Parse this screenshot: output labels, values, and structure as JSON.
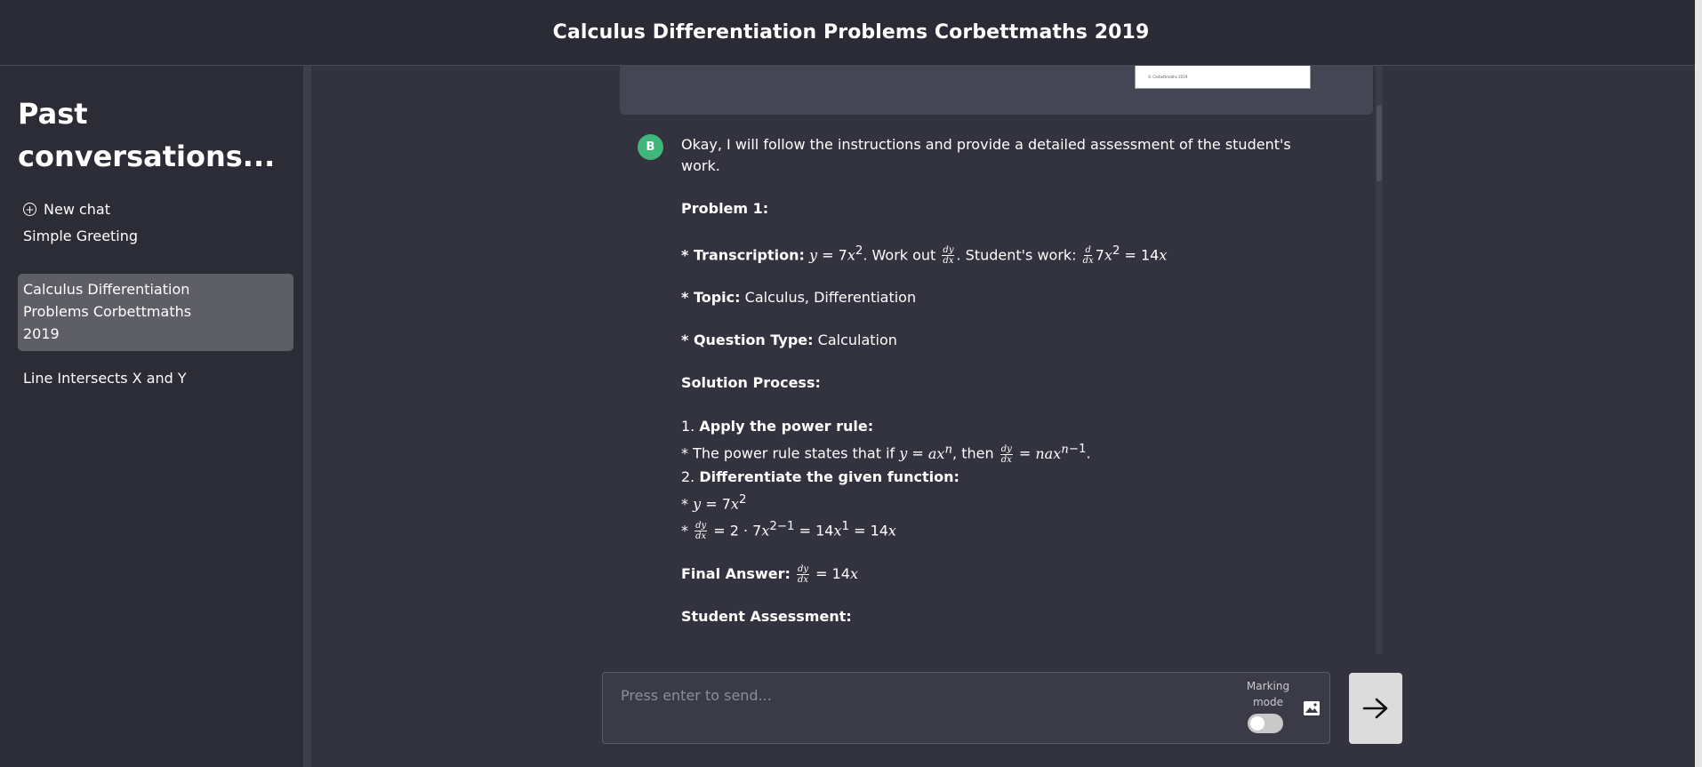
{
  "header": {
    "title": "Calculus Differentiation Problems Corbettmaths 2019"
  },
  "sidebar": {
    "heading": "Past conversations...",
    "new_chat_label": "New chat",
    "conversations": [
      {
        "label": "Simple Greeting"
      },
      {
        "label": "Calculus Differentiation Problems Corbettmaths 2019"
      },
      {
        "label": "Line Intersects X and Y"
      }
    ]
  },
  "chat": {
    "image_caption": "© Corbettmaths 2019",
    "assistant_avatar": "B",
    "message": {
      "intro": "Okay, I will follow the instructions and provide a detailed assessment of the student's work.",
      "problem_heading": "Problem 1:",
      "transcription_label": "* Transcription:",
      "transcription_text_1": ". Work out",
      "transcription_text_2": ". Student's work:",
      "topic_label": "* Topic:",
      "topic_value": "Calculus, Differentiation",
      "qtype_label": "* Question Type:",
      "qtype_value": "Calculation",
      "solution_heading": "Solution Process:",
      "step1_prefix": "1.",
      "step1_label": "Apply the power rule:",
      "step1_text": "* The power rule states that if",
      "step1_then": ", then",
      "step2_prefix": "2.",
      "step2_label": "Differentiate the given function:",
      "final_label": "Final Answer:",
      "assessment_heading": "Student Assessment:"
    }
  },
  "composer": {
    "placeholder": "Press enter to send...",
    "marking_mode_label": "Marking mode",
    "marking_mode_on": false
  },
  "icons": {
    "new_chat": "plus-circle-icon",
    "image_upload": "image-icon",
    "send": "arrow-right-icon"
  },
  "colors": {
    "background": "#32333e",
    "sidebar": "#2b2c35",
    "avatar": "#3fb77a",
    "active_conversation": "#5e5e67"
  }
}
